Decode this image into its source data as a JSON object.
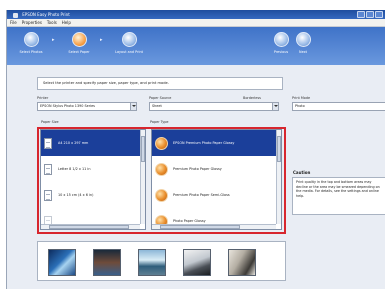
{
  "window": {
    "title": "EPSON Easy Photo Print"
  },
  "menu": [
    "File",
    "Properties",
    "Tools",
    "Help"
  ],
  "steps": [
    {
      "label": "Select Photos",
      "active": false
    },
    {
      "label": "Select Paper",
      "active": true
    },
    {
      "label": "Layout and Print",
      "active": false
    }
  ],
  "right_steps": [
    {
      "label": "Previous"
    },
    {
      "label": "Next"
    }
  ],
  "hint": "Select the printer and specify paper size, paper type, and print mode.",
  "printer": {
    "label": "Printer",
    "value": "EPSON Stylus Photo 1390 Series"
  },
  "paper_source": {
    "label": "Paper Source",
    "value": "Sheet"
  },
  "borderless_label": "Borderless",
  "print_mode": {
    "label": "Print Mode",
    "value": "Photo"
  },
  "paper_size": {
    "label": "Paper Size",
    "items": [
      {
        "text": "A4 210 x 297 mm",
        "selected": true
      },
      {
        "text": "Letter 8 1/2 x 11 in",
        "selected": false
      },
      {
        "text": "10 x 15 cm (4 x 6 in)",
        "selected": false
      },
      {
        "text": "",
        "selected": false
      }
    ]
  },
  "paper_type": {
    "label": "Paper Type",
    "items": [
      {
        "text": "EPSON Premium Photo Paper Glossy",
        "selected": true
      },
      {
        "text": "Premium Photo Paper Glossy",
        "selected": false
      },
      {
        "text": "Premium Photo Paper Semi-Gloss",
        "selected": false
      },
      {
        "text": "Photo Paper Glossy",
        "selected": false
      }
    ]
  },
  "caution": {
    "title": "Caution",
    "text": "Print quality in the top and bottom areas may decline or the area may be smeared depending on the media. For details, see the settings and online help."
  },
  "colors": {
    "accent": "#3f73c8",
    "selection": "#1b3f9a",
    "highlight": "#d7262e"
  }
}
